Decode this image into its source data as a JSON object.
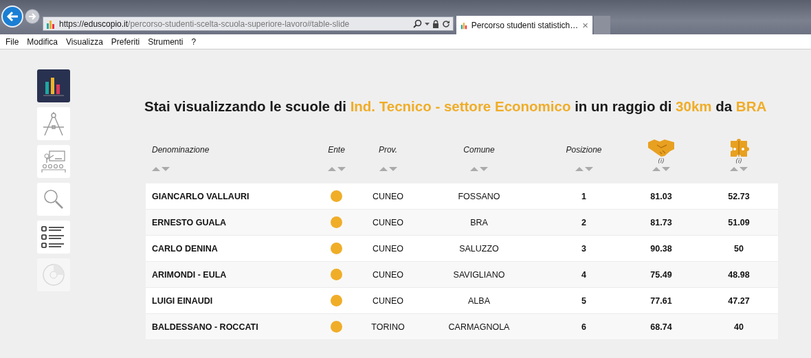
{
  "browser": {
    "address": {
      "protocol": "https://",
      "domain": "eduscopio.it",
      "path": "/percorso-studenti-scelta-scuola-superiore-lavoro#table-slide"
    },
    "tab": {
      "title": "Percorso studenti statistich…",
      "close": "×"
    },
    "menu": [
      "File",
      "Modifica",
      "Visualizza",
      "Preferiti",
      "Strumenti",
      "?"
    ]
  },
  "sidebar": {
    "items": [
      {
        "kind": "chart",
        "selected": true,
        "disabled": false
      },
      {
        "kind": "compass",
        "selected": false,
        "disabled": false
      },
      {
        "kind": "teacher",
        "selected": false,
        "disabled": false
      },
      {
        "kind": "search",
        "selected": false,
        "disabled": false
      },
      {
        "kind": "checklist",
        "selected": false,
        "disabled": false
      },
      {
        "kind": "disc",
        "selected": false,
        "disabled": true
      }
    ]
  },
  "heading": [
    {
      "text": "Stai visualizzando le scuole di ",
      "highlight": false
    },
    {
      "text": "Ind. Tecnico - settore Economico",
      "highlight": true
    },
    {
      "text": " in un raggio di ",
      "highlight": false
    },
    {
      "text": "30km",
      "highlight": true
    },
    {
      "text": " da ",
      "highlight": false
    },
    {
      "text": "BRA",
      "highlight": true
    }
  ],
  "table": {
    "columns": [
      {
        "kind": "text",
        "label": "Denominazione"
      },
      {
        "kind": "text",
        "label": "Ente"
      },
      {
        "kind": "text",
        "label": "Prov."
      },
      {
        "kind": "text",
        "label": "Comune"
      },
      {
        "kind": "text",
        "label": "Posizione"
      },
      {
        "kind": "handshake",
        "info": "(i)"
      },
      {
        "kind": "puzzle",
        "info": "(i)"
      }
    ],
    "rows": [
      {
        "name": "GIANCARLO VALLAURI",
        "ente": {
          "color": "#f0ad28"
        },
        "prov": "CUNEO",
        "comune": "FOSSANO",
        "posizione": "1",
        "column_6": "81.03",
        "column_7": "52.73"
      },
      {
        "name": "ERNESTO GUALA",
        "ente": {
          "color": "#f0ad28"
        },
        "prov": "CUNEO",
        "comune": "BRA",
        "posizione": "2",
        "column_6": "81.73",
        "column_7": "51.09"
      },
      {
        "name": "CARLO DENINA",
        "ente": {
          "color": "#f0ad28"
        },
        "prov": "CUNEO",
        "comune": "SALUZZO",
        "posizione": "3",
        "column_6": "90.38",
        "column_7": "50"
      },
      {
        "name": "ARIMONDI - EULA",
        "ente": {
          "color": "#f0ad28"
        },
        "prov": "CUNEO",
        "comune": "SAVIGLIANO",
        "posizione": "4",
        "column_6": "75.49",
        "column_7": "48.98"
      },
      {
        "name": "LUIGI EINAUDI",
        "ente": {
          "color": "#f0ad28"
        },
        "prov": "CUNEO",
        "comune": "ALBA",
        "posizione": "5",
        "column_6": "77.61",
        "column_7": "47.27"
      },
      {
        "name": "BALDESSANO - ROCCATI",
        "ente": {
          "color": "#f0ad28"
        },
        "prov": "TORINO",
        "comune": "CARMAGNOLA",
        "posizione": "6",
        "column_6": "68.74",
        "column_7": "40"
      }
    ]
  }
}
